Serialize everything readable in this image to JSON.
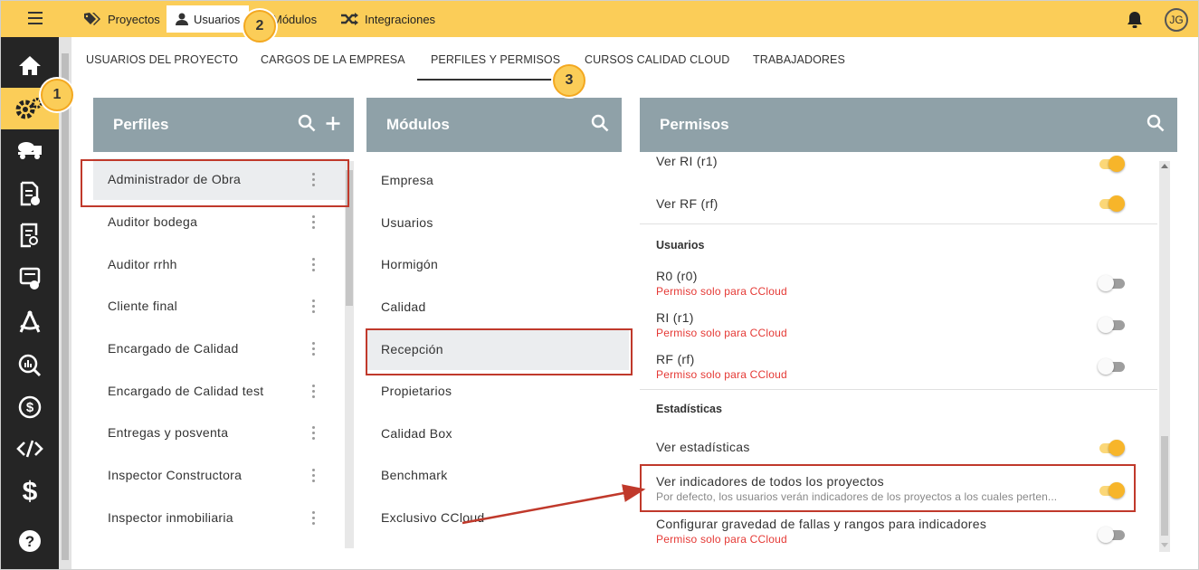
{
  "topnav": {
    "tabs": [
      {
        "label": "Proyectos",
        "icon": "tag-icon"
      },
      {
        "label": "Usuarios",
        "icon": "user-icon"
      },
      {
        "label": "Módulos",
        "icon": "module-icon"
      },
      {
        "label": "Integraciones",
        "icon": "shuffle-icon"
      }
    ],
    "active_tab": "Usuarios",
    "avatar_initials": "JG",
    "accent_color": "#fbcd58"
  },
  "sidebar": {
    "items": [
      "home-icon",
      "gears-icon",
      "mixer-truck-icon",
      "document-check-icon",
      "document-search-icon",
      "certificate-icon",
      "compass-icon",
      "analytics-icon",
      "dollar-circle-icon",
      "code-icon",
      "dollar-icon",
      "help-icon"
    ],
    "active_item": "gears-icon"
  },
  "subtabs": [
    "USUARIOS DEL PROYECTO",
    "CARGOS DE LA EMPRESA",
    "PERFILES Y PERMISOS",
    "CURSOS CALIDAD CLOUD",
    "TRABAJADORES"
  ],
  "active_subtab": "PERFILES Y PERMISOS",
  "badges": [
    "1",
    "2",
    "3"
  ],
  "perfiles": {
    "title": "Perfiles",
    "items": [
      "Administrador de Obra",
      "Auditor bodega",
      "Auditor rrhh",
      "Cliente final",
      "Encargado de Calidad",
      "Encargado de Calidad test",
      "Entregas y posventa",
      "Inspector Constructora",
      "Inspector inmobiliaria"
    ],
    "selected": "Administrador de Obra"
  },
  "modulos": {
    "title": "Módulos",
    "items": [
      "Empresa",
      "Usuarios",
      "Hormigón",
      "Calidad",
      "Recepción",
      "Propietarios",
      "Calidad Box",
      "Benchmark",
      "Exclusivo CCloud"
    ],
    "selected": "Recepción"
  },
  "permisos": {
    "title": "Permisos",
    "partial_top": "Ver RI (r1)",
    "rows": [
      {
        "label": "Ver RF (rf)",
        "on": true
      },
      {
        "section": "Usuarios"
      },
      {
        "label": "R0 (r0)",
        "note": "Permiso solo para CCloud",
        "on": false
      },
      {
        "label": "RI (r1)",
        "note": "Permiso solo para CCloud",
        "on": false
      },
      {
        "label": "RF (rf)",
        "note": "Permiso solo para CCloud",
        "on": false
      },
      {
        "section": "Estadísticas"
      },
      {
        "label": "Ver estadísticas",
        "on": true
      },
      {
        "label": "Ver indicadores de todos los proyectos",
        "desc": "Por defecto, los usuarios verán indicadores de los proyectos a los cuales perten...",
        "on": true
      },
      {
        "label": "Configurar gravedad de fallas y rangos para indicadores",
        "note": "Permiso solo para CCloud",
        "on": false
      }
    ]
  }
}
